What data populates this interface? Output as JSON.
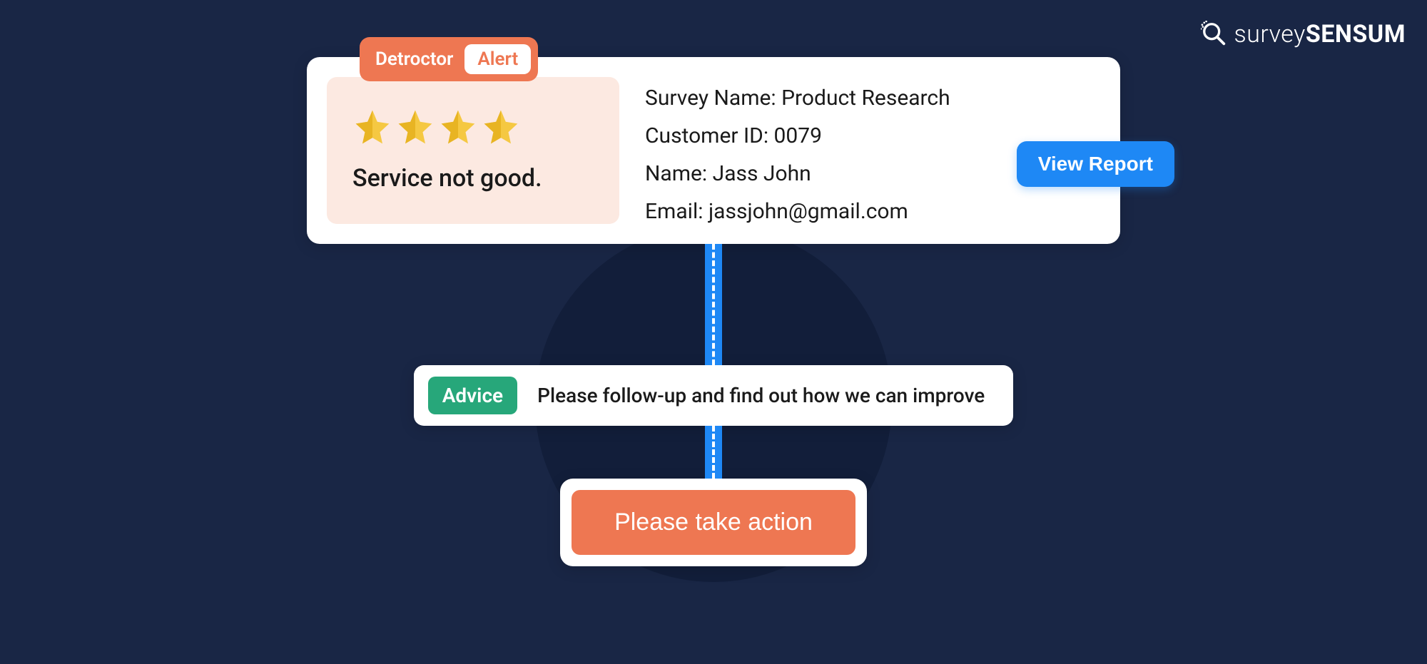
{
  "brand": {
    "name_light": "survey",
    "name_bold": "SENSUM"
  },
  "alert": {
    "detractor_label": "Detroctor",
    "alert_label": "Alert",
    "feedback_text": "Service not good.",
    "rating": 4,
    "view_report_label": "View Report",
    "details": {
      "survey_name_label": "Survey Name: Product Research",
      "customer_id_label": "Customer ID: 0079",
      "name_label": "Name: Jass John",
      "email_label": "Email: jassjohn@gmail.com"
    }
  },
  "advice": {
    "chip": "Advice",
    "text": "Please follow-up and find out how we can improve"
  },
  "action": {
    "label": "Please take action"
  },
  "colors": {
    "accent_orange": "#EE7752",
    "accent_blue": "#1E88F5",
    "accent_green": "#27A77A",
    "bg_dark": "#192645"
  }
}
